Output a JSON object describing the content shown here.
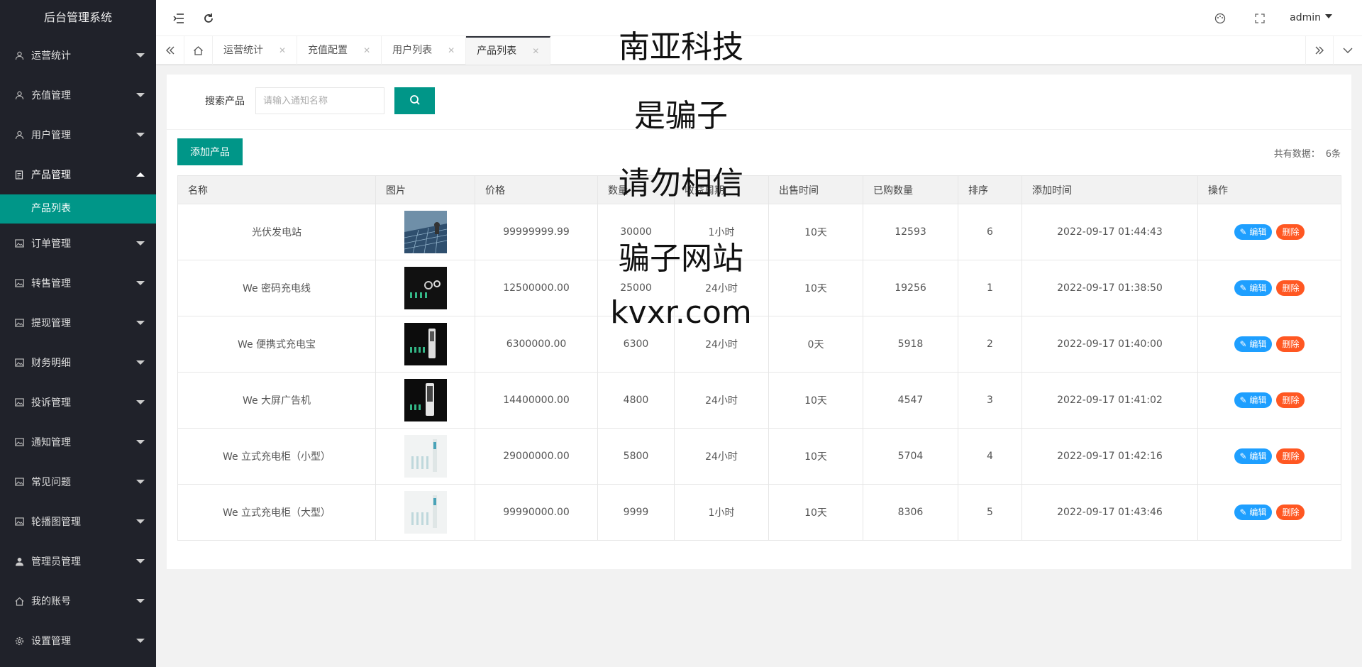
{
  "app_title": "后台管理系统",
  "sidebar": {
    "items": [
      {
        "label": "运营统计",
        "icon": "user-icon"
      },
      {
        "label": "充值管理",
        "icon": "user-icon"
      },
      {
        "label": "用户管理",
        "icon": "user-icon"
      },
      {
        "label": "产品管理",
        "icon": "document-icon",
        "open": true
      },
      {
        "label": "订单管理",
        "icon": "image-icon"
      },
      {
        "label": "转售管理",
        "icon": "image-icon"
      },
      {
        "label": "提现管理",
        "icon": "image-icon"
      },
      {
        "label": "财务明细",
        "icon": "image-icon"
      },
      {
        "label": "投诉管理",
        "icon": "image-icon"
      },
      {
        "label": "通知管理",
        "icon": "image-icon"
      },
      {
        "label": "常见问题",
        "icon": "image-icon"
      },
      {
        "label": "轮播图管理",
        "icon": "image-icon"
      },
      {
        "label": "管理员管理",
        "icon": "person-icon"
      },
      {
        "label": "我的账号",
        "icon": "home-icon"
      },
      {
        "label": "设置管理",
        "icon": "gear-icon"
      }
    ],
    "sub_item": "产品列表"
  },
  "header": {
    "user": "admin"
  },
  "tabs": [
    {
      "label": "运营统计"
    },
    {
      "label": "充值配置"
    },
    {
      "label": "用户列表"
    },
    {
      "label": "产品列表",
      "active": true
    }
  ],
  "search": {
    "label": "搜索产品",
    "placeholder": "请输入通知名称"
  },
  "add_button": "添加产品",
  "total": {
    "label": "共有数据：",
    "value": "6条"
  },
  "table": {
    "columns": [
      "名称",
      "图片",
      "价格",
      "数量",
      "收益周期",
      "出售时间",
      "已购数量",
      "排序",
      "添加时间",
      "操作"
    ],
    "rows": [
      {
        "name": "光伏发电站",
        "image": "solar-panel-photo",
        "price": "99999999.99",
        "qty": "30000",
        "period": "1小时",
        "sale_time": "10天",
        "bought": "12593",
        "sort": "6",
        "added": "2022-09-17 01:44:43"
      },
      {
        "name": "We 密码充电线",
        "image": "charging-cable-photo",
        "price": "12500000.00",
        "qty": "25000",
        "period": "24小时",
        "sale_time": "10天",
        "bought": "19256",
        "sort": "1",
        "added": "2022-09-17 01:38:50"
      },
      {
        "name": "We 便携式充电宝",
        "image": "power-bank-photo",
        "price": "6300000.00",
        "qty": "6300",
        "period": "24小时",
        "sale_time": "0天",
        "bought": "5918",
        "sort": "2",
        "added": "2022-09-17 01:40:00"
      },
      {
        "name": "We 大屏广告机",
        "image": "ad-screen-photo",
        "price": "14400000.00",
        "qty": "4800",
        "period": "24小时",
        "sale_time": "10天",
        "bought": "4547",
        "sort": "3",
        "added": "2022-09-17 01:41:02"
      },
      {
        "name": "We 立式充电柜（小型）",
        "image": "charging-cabinet-small-photo",
        "price": "29000000.00",
        "qty": "5800",
        "period": "24小时",
        "sale_time": "10天",
        "bought": "5704",
        "sort": "4",
        "added": "2022-09-17 01:42:16"
      },
      {
        "name": "We 立式充电柜（大型）",
        "image": "charging-cabinet-large-photo",
        "price": "99990000.00",
        "qty": "9999",
        "period": "1小时",
        "sale_time": "10天",
        "bought": "8306",
        "sort": "5",
        "added": "2022-09-17 01:43:46"
      }
    ],
    "edit_label": "编辑",
    "delete_label": "删除"
  },
  "watermark": [
    "南亚科技",
    "是骗子",
    "请勿相信",
    "骗子网站",
    "kvxr.com"
  ],
  "colors": {
    "sidebar_bg": "#20222A",
    "accent": "#009688",
    "edit": "#1E9FFF",
    "delete": "#FF5722"
  }
}
